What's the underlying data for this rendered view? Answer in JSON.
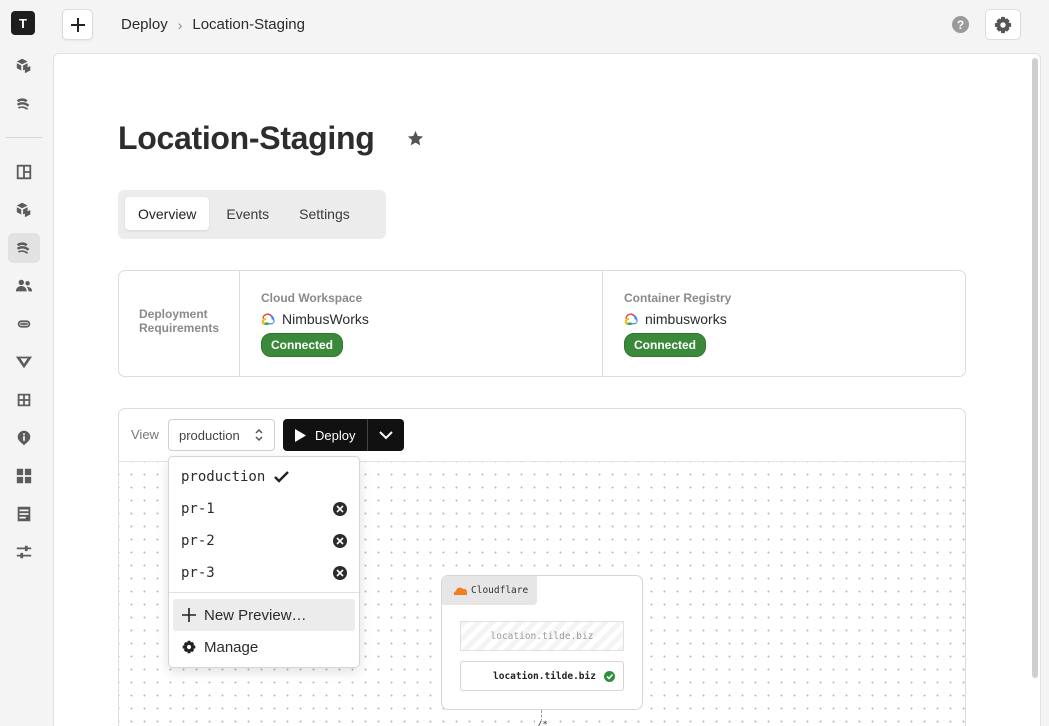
{
  "sidebar": {
    "avatar_letter": "T",
    "icons": [
      "packages-icon",
      "deploy-icon",
      "dashboard-icon",
      "packages-icon",
      "deploy-icon",
      "team-icon",
      "link-icon",
      "vercel-icon",
      "integration-icon",
      "info-icon",
      "apps-icon",
      "docs-icon",
      "sliders-icon"
    ],
    "active_icon": "deploy-icon"
  },
  "breadcrumb": {
    "parent": "Deploy",
    "separator": "›",
    "current": "Location-Staging"
  },
  "help_label": "?",
  "page": {
    "title": "Location-Staging"
  },
  "tabs": [
    {
      "label": "Overview",
      "active": true
    },
    {
      "label": "Events",
      "active": false
    },
    {
      "label": "Settings",
      "active": false
    }
  ],
  "requirements": {
    "label": "Deployment Requirements",
    "cloud_workspace": {
      "title": "Cloud Workspace",
      "value": "NimbusWorks",
      "status": "Connected"
    },
    "container_registry": {
      "title": "Container Registry",
      "value": "nimbusworks",
      "status": "Connected"
    },
    "status_color": "#3b8a3b"
  },
  "deploy": {
    "view_label": "View",
    "selected_env": "production",
    "deploy_label": "Deploy"
  },
  "dropdown": {
    "options": [
      {
        "label": "production",
        "selected": true
      },
      {
        "label": "pr-1",
        "selected": false
      },
      {
        "label": "pr-2",
        "selected": false
      },
      {
        "label": "pr-3",
        "selected": false
      }
    ],
    "new_preview_label": "New Preview…",
    "manage_label": "Manage"
  },
  "canvas": {
    "provider": "Cloudflare",
    "provider_color": "#f38020",
    "ghost_route": "location.tilde.biz",
    "route": "location.tilde.biz",
    "path": "/*"
  }
}
